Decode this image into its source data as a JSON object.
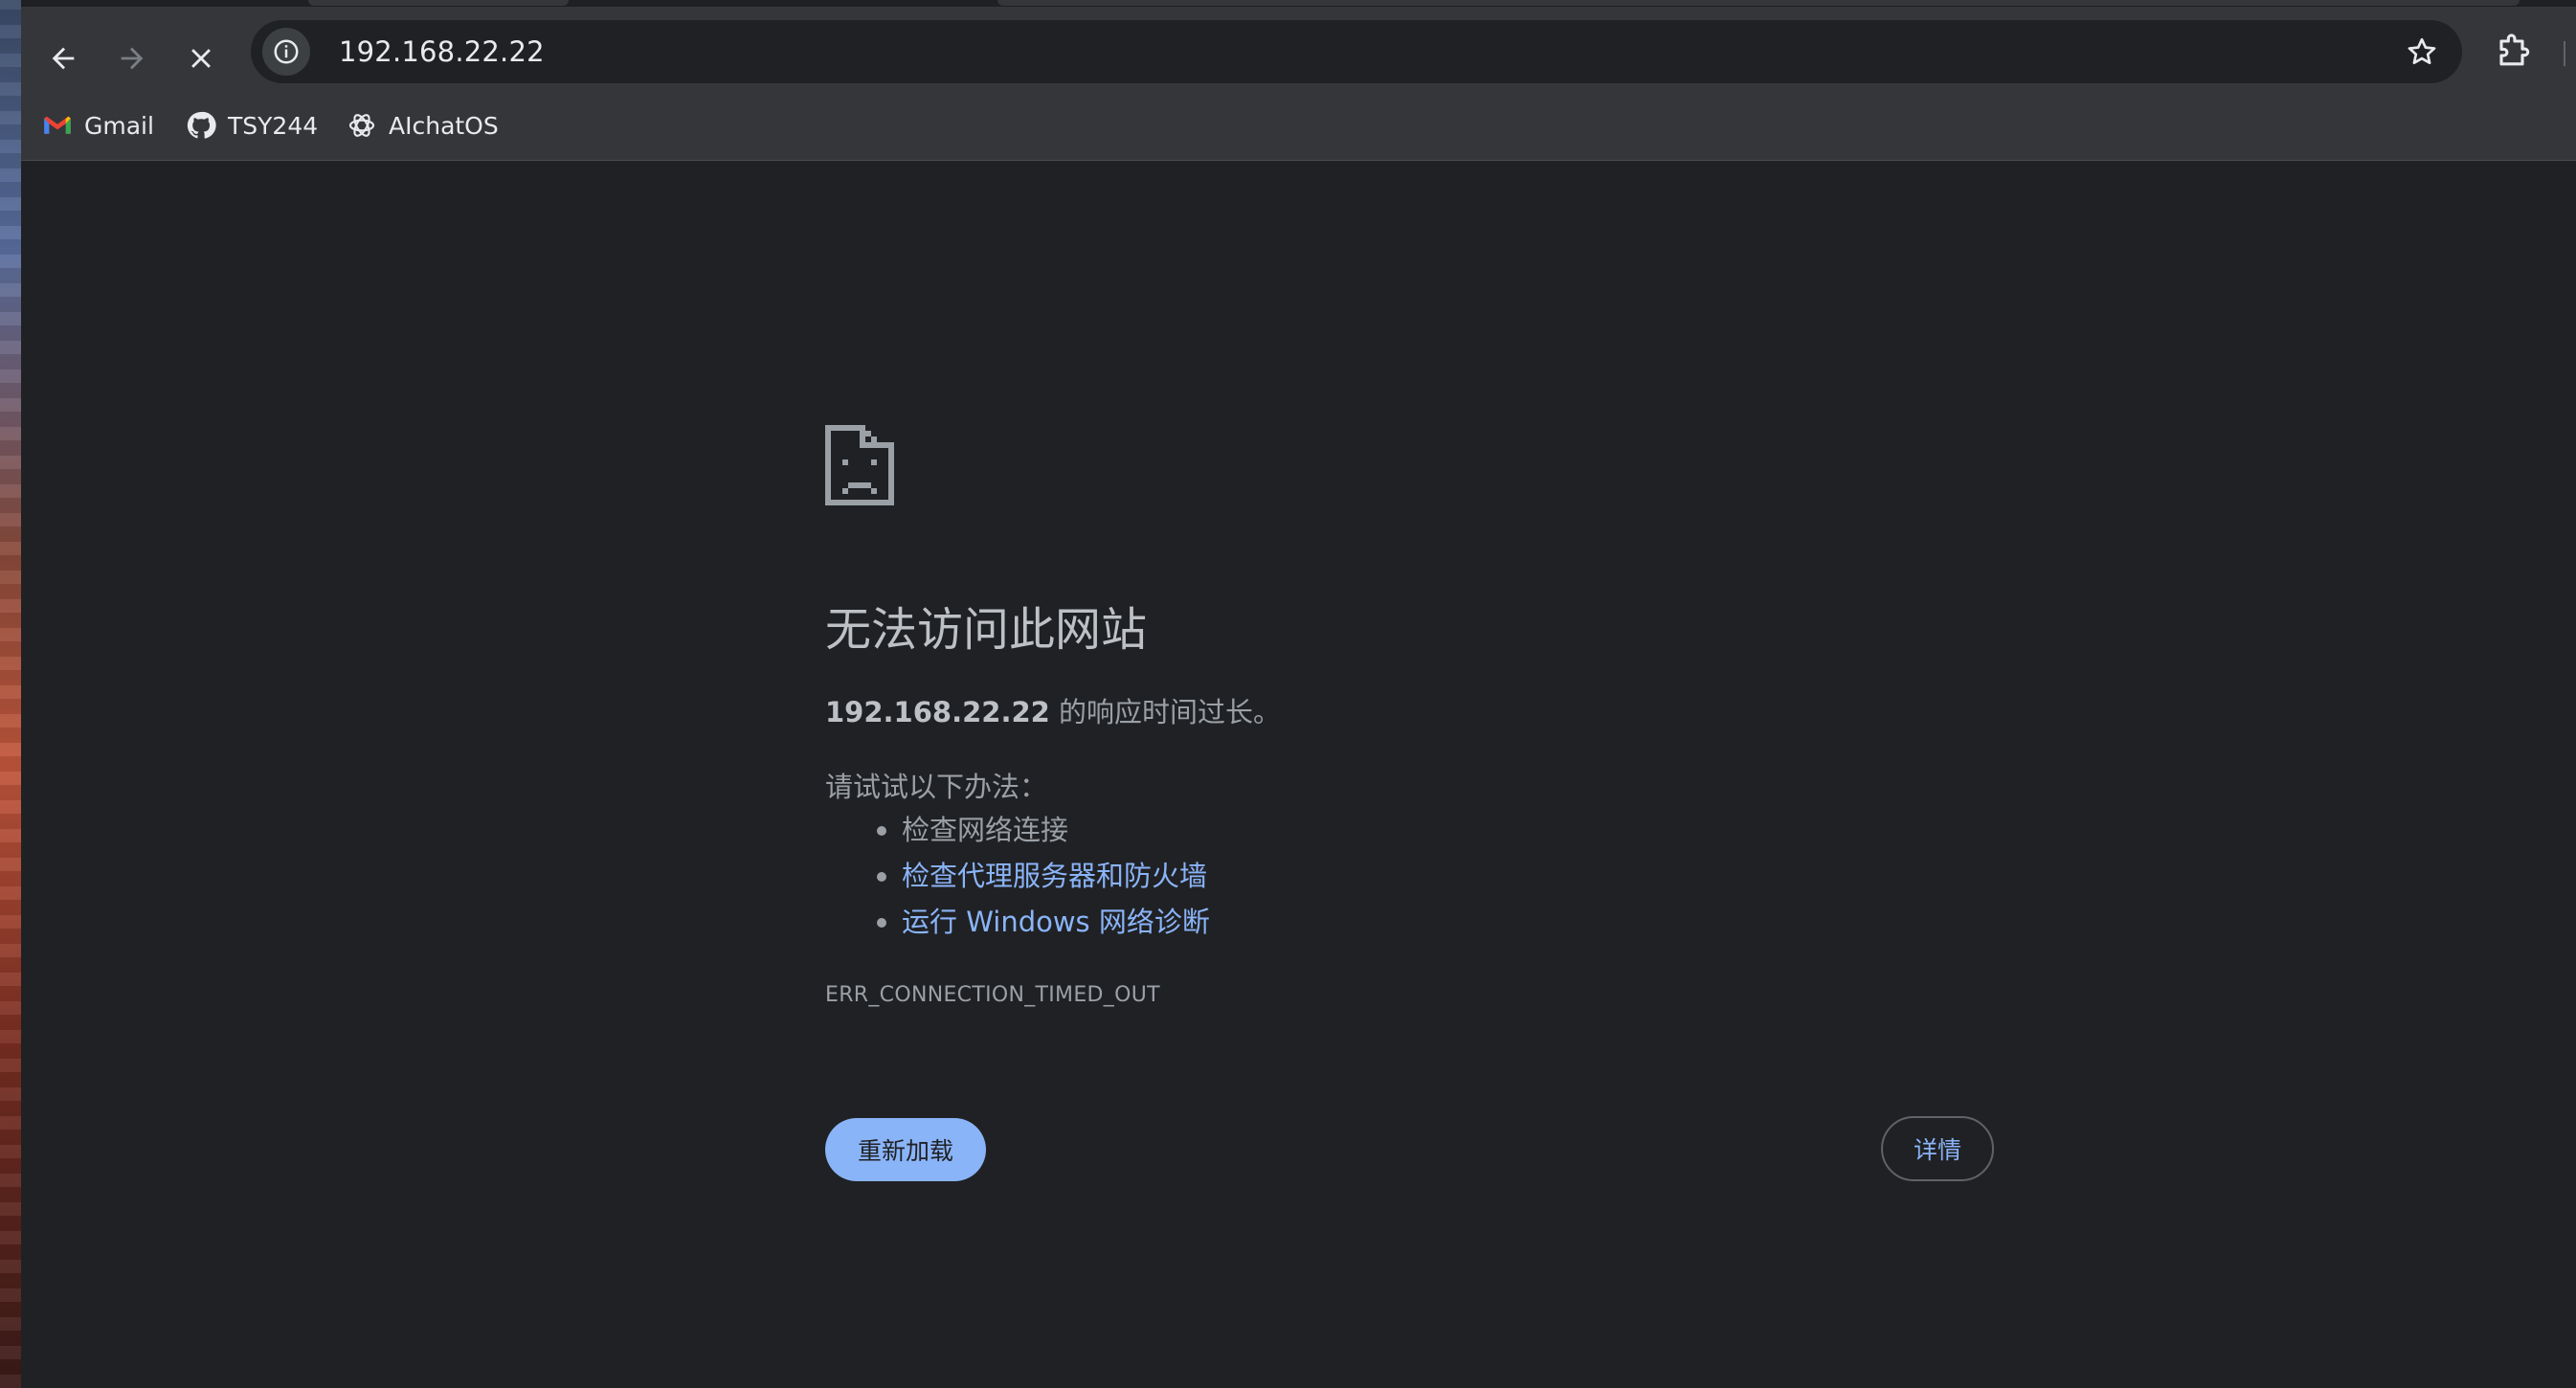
{
  "browser": {
    "address_bar": {
      "url": "192.168.22.22"
    },
    "bookmarks": [
      {
        "label": "Gmail",
        "icon": "gmail-icon"
      },
      {
        "label": "TSY244",
        "icon": "github-icon"
      },
      {
        "label": "AIchatOS",
        "icon": "openai-icon"
      }
    ]
  },
  "error_page": {
    "title": "无法访问此网站",
    "host": "192.168.22.22",
    "description_suffix": " 的响应时间过长。",
    "try_label": "请试试以下办法：",
    "suggestions": [
      {
        "text": "检查网络连接",
        "is_link": false
      },
      {
        "text": "检查代理服务器和防火墙",
        "is_link": true
      },
      {
        "text": "运行 Windows 网络诊断",
        "is_link": true
      }
    ],
    "error_code": "ERR_CONNECTION_TIMED_OUT",
    "reload_label": "重新加载",
    "details_label": "详情"
  },
  "colors": {
    "page_bg": "#202124",
    "toolbar_bg": "#35363a",
    "link": "#8ab4f8",
    "button_bg": "#8ab4f8"
  }
}
